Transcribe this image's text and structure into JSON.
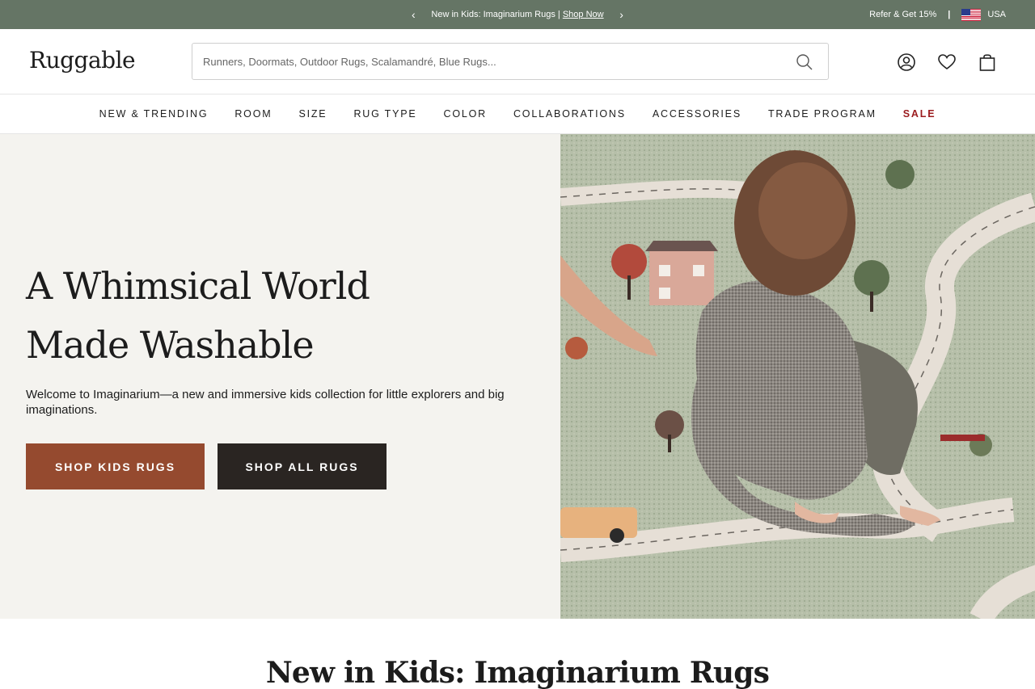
{
  "announcement": {
    "prev_icon": "chevron-left-icon",
    "next_icon": "chevron-right-icon",
    "text": "New in Kids: Imaginarium Rugs |",
    "link": "Shop Now"
  },
  "utility": {
    "refer": "Refer & Get 15%",
    "separator": "|",
    "country": "USA",
    "flag_icon": "us-flag-icon"
  },
  "header": {
    "logo": "Ruggable",
    "search_placeholder": "Runners, Doormats, Outdoor Rugs, Scalamandré, Blue Rugs...",
    "icons": [
      "search-icon",
      "account-icon",
      "heart-icon",
      "bag-icon"
    ]
  },
  "nav": {
    "items": [
      "NEW & TRENDING",
      "ROOM",
      "SIZE",
      "RUG TYPE",
      "COLOR",
      "COLLABORATIONS",
      "ACCESSORIES",
      "TRADE PROGRAM",
      "SALE"
    ]
  },
  "hero": {
    "title_line1": "A Whimsical World",
    "title_line2": "Made Washable",
    "subtitle": "Welcome to Imaginarium—a new and immersive kids collection for little explorers and big imaginations.",
    "button_kids": "SHOP KIDS RUGS",
    "button_all": "SHOP ALL RUGS"
  },
  "section": {
    "title": "New in Kids: Imaginarium Rugs"
  },
  "colors": {
    "topbar": "#657565",
    "accent_rust": "#954a2f",
    "dark_button": "#2a2522",
    "sale": "#9b1b1e",
    "hero_bg": "#f4f3ef"
  }
}
